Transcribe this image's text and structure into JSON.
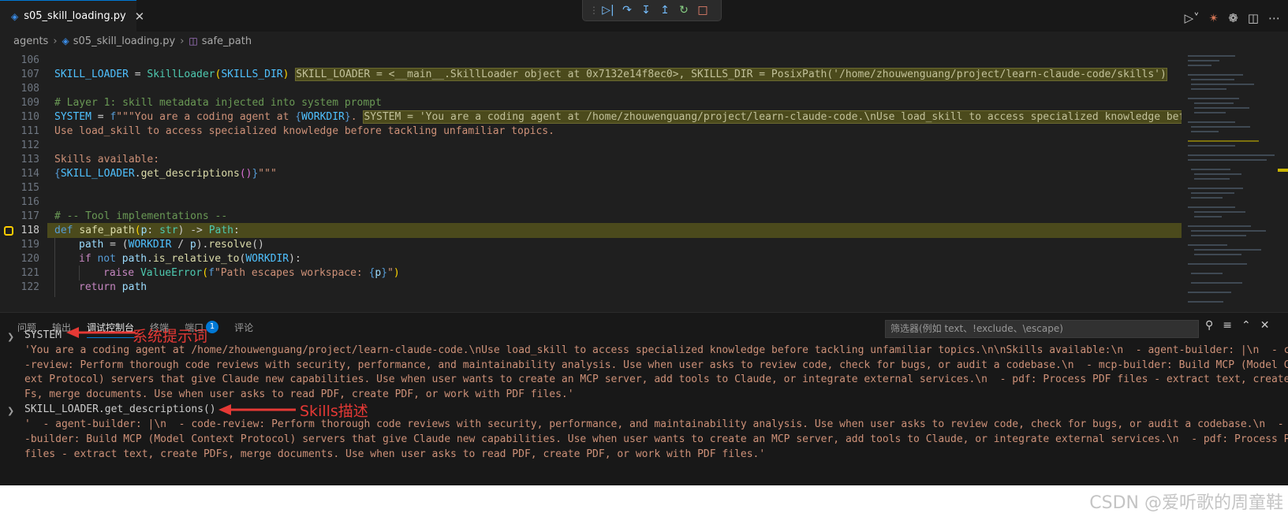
{
  "tab": {
    "icon": "python-file-icon",
    "title": "s05_skill_loading.py",
    "close": "✕"
  },
  "debug_toolbar": {
    "buttons": [
      "continue-icon",
      "step-over-icon",
      "step-into-icon",
      "step-out-icon",
      "restart-icon",
      "stop-icon"
    ]
  },
  "breadcrumb": {
    "folder": "agents",
    "file": "s05_skill_loading.py",
    "symbol": "safe_path"
  },
  "editor": {
    "line_numbers": [
      "106",
      "107",
      "108",
      "109",
      "110",
      "111",
      "112",
      "113",
      "114",
      "115",
      "116",
      "117",
      "118",
      "119",
      "120",
      "121",
      "122"
    ],
    "active_line": "118",
    "lines": {
      "l107": {
        "a": "SKILL_LOADER",
        "b": " = ",
        "c": "SkillLoader",
        "d": "(",
        "e": "SKILLS_DIR",
        "f": ")",
        "inlay": "SKILL_LOADER = <__main__.SkillLoader object at 0x7132e14f8ec0>, SKILLS_DIR = PosixPath('/home/zhouwenguang/project/learn-claude-code/skills')"
      },
      "l109": {
        "comment": "# Layer 1: skill metadata injected into system prompt"
      },
      "l110": {
        "a": "SYSTEM",
        "b": " = ",
        "c": "f",
        "d": "\"\"\"You are a coding agent at ",
        "e": "{",
        "f": "WORKDIR",
        "g": "}",
        "h": ".",
        "inlay": "SYSTEM = 'You are a coding agent at /home/zhouwenguang/project/learn-claude-code.\\nUse load_skill to access specialized knowledge before"
      },
      "l111": {
        "text": "Use load_skill to access specialized knowledge before tackling unfamiliar topics."
      },
      "l113": {
        "text": "Skills available:"
      },
      "l114": {
        "a": "{",
        "b": "SKILL_LOADER",
        "c": ".",
        "d": "get_descriptions",
        "e": "()",
        "f": "}",
        "g": "\"\"\""
      },
      "l117": {
        "comment": "# -- Tool implementations --"
      },
      "l118": {
        "a": "def",
        "b": " ",
        "c": "safe_path",
        "d": "(",
        "e": "p",
        "f": ": ",
        "g": "str",
        "h": ") -> ",
        "i": "Path",
        "j": ":"
      },
      "l119": {
        "a": "path",
        "b": " = (",
        "c": "WORKDIR",
        "d": " / ",
        "e": "p",
        "f": ").",
        "g": "resolve",
        "h": "()"
      },
      "l120": {
        "a": "if",
        "b": " ",
        "c": "not",
        "d": " ",
        "e": "path",
        "f": ".",
        "g": "is_relative_to",
        "h": "(",
        "i": "WORKDIR",
        "j": "):"
      },
      "l121": {
        "a": "raise",
        "b": " ",
        "c": "ValueError",
        "d": "(",
        "e": "f",
        "f": "\"Path escapes workspace: ",
        "g": "{",
        "h": "p",
        "i": "}",
        "j": "\"",
        "k": ")"
      },
      "l122": {
        "a": "return",
        "b": " ",
        "c": "path"
      }
    }
  },
  "panel": {
    "tabs": [
      "问题",
      "输出",
      "调试控制台",
      "终端",
      "端口",
      "评论"
    ],
    "active_tab": "调试控制台",
    "ports_badge": "1",
    "filter_placeholder": "筛选器(例如 text、!exclude、\\escape)",
    "console": [
      {
        "type": "expr",
        "text": "SYSTEM"
      },
      {
        "type": "result",
        "text": "'You are a coding agent at /home/zhouwenguang/project/learn-claude-code.\\nUse load_skill to access specialized knowledge before tackling unfamiliar topics.\\n\\nSkills available:\\n  - agent-builder: |\\n  - code"
      },
      {
        "type": "result",
        "text": "-review: Perform thorough code reviews with security, performance, and maintainability analysis. Use when user asks to review code, check for bugs, or audit a codebase.\\n  - mcp-builder: Build MCP (Model Cont"
      },
      {
        "type": "result",
        "text": "ext Protocol) servers that give Claude new capabilities. Use when user wants to create an MCP server, add tools to Claude, or integrate external services.\\n  - pdf: Process PDF files - extract text, create PD"
      },
      {
        "type": "result",
        "text": "Fs, merge documents. Use when user asks to read PDF, create PDF, or work with PDF files.'"
      },
      {
        "type": "expr",
        "text": "SKILL_LOADER.get_descriptions()"
      },
      {
        "type": "result",
        "text": "'  - agent-builder: |\\n  - code-review: Perform thorough code reviews with security, performance, and maintainability analysis. Use when user asks to review code, check for bugs, or audit a codebase.\\n  - mcp"
      },
      {
        "type": "result",
        "text": "-builder: Build MCP (Model Context Protocol) servers that give Claude new capabilities. Use when user wants to create an MCP server, add tools to Claude, or integrate external services.\\n  - pdf: Process PDF"
      },
      {
        "type": "result",
        "text": "files - extract text, create PDFs, merge documents. Use when user asks to read PDF, create PDF, or work with PDF files.'"
      }
    ],
    "annotations": {
      "system": "系统提示词",
      "skills": "Skills描述"
    }
  },
  "watermark": "CSDN @爱听歌的周童鞋",
  "colors": {
    "annotation": "#e53935",
    "accent": "#0078d4",
    "inlay_bg": "#4b4a1c"
  }
}
